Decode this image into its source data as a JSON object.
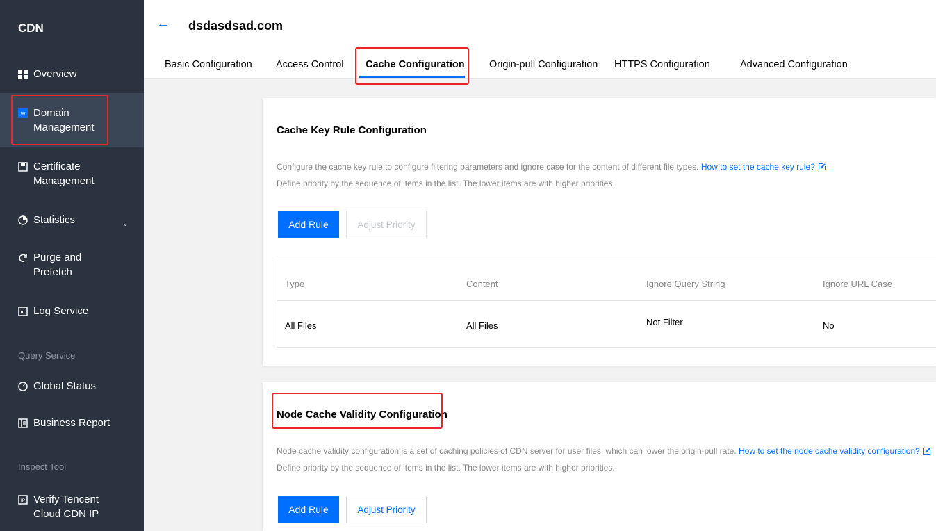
{
  "sidebar": {
    "title": "CDN",
    "items": [
      {
        "label": "Overview",
        "icon": "grid-icon"
      },
      {
        "label_line1": "Domain",
        "label_line2": "Management",
        "icon": "domain-icon"
      },
      {
        "label_line1": "Certificate",
        "label_line2": "Management",
        "icon": "certificate-icon"
      },
      {
        "label": "Statistics",
        "icon": "pie-chart-icon"
      },
      {
        "label_line1": "Purge and",
        "label_line2": "Prefetch",
        "icon": "refresh-icon"
      },
      {
        "label": "Log Service",
        "icon": "log-icon"
      },
      {
        "label": "Global Status",
        "icon": "gauge-icon"
      },
      {
        "label": "Business Report",
        "icon": "report-icon"
      },
      {
        "label_line1": "Verify Tencent",
        "label_line2": "Cloud CDN IP",
        "icon": "ip-icon"
      }
    ],
    "sections": {
      "query": "Query Service",
      "inspect": "Inspect Tool"
    }
  },
  "header": {
    "domain": "dsdasdsad.com",
    "tabs": [
      "Basic Configuration",
      "Access Control",
      "Cache Configuration",
      "Origin-pull Configuration",
      "HTTPS Configuration",
      "Advanced Configuration"
    ]
  },
  "cache_key": {
    "title": "Cache Key Rule Configuration",
    "desc1": "Configure the cache key rule to configure filtering parameters and ignore case for the content of different file types.",
    "link": "How to set the cache key rule?",
    "desc2": "Define priority by the sequence of items in the list. The lower items are with higher priorities.",
    "add_rule": "Add Rule",
    "adjust_priority": "Adjust Priority",
    "table": {
      "columns": [
        "Type",
        "Content",
        "Ignore Query String",
        "Ignore URL Case"
      ],
      "rows": [
        [
          "All Files",
          "All Files",
          "Not Filter",
          "No"
        ]
      ]
    }
  },
  "node_cache": {
    "title": "Node Cache Validity Configuration",
    "desc1": "Node cache validity configuration is a set of caching policies of CDN server for user files, which can lower the origin-pull rate.",
    "link": "How to set the node cache validity configuration?",
    "desc2": "Define priority by the sequence of items in the list. The lower items are with higher priorities.",
    "add_rule": "Add Rule",
    "adjust_priority": "Adjust Priority"
  },
  "colors": {
    "accent": "#006eff",
    "sidebar": "#2b3341",
    "highlight": "#e5262b"
  }
}
